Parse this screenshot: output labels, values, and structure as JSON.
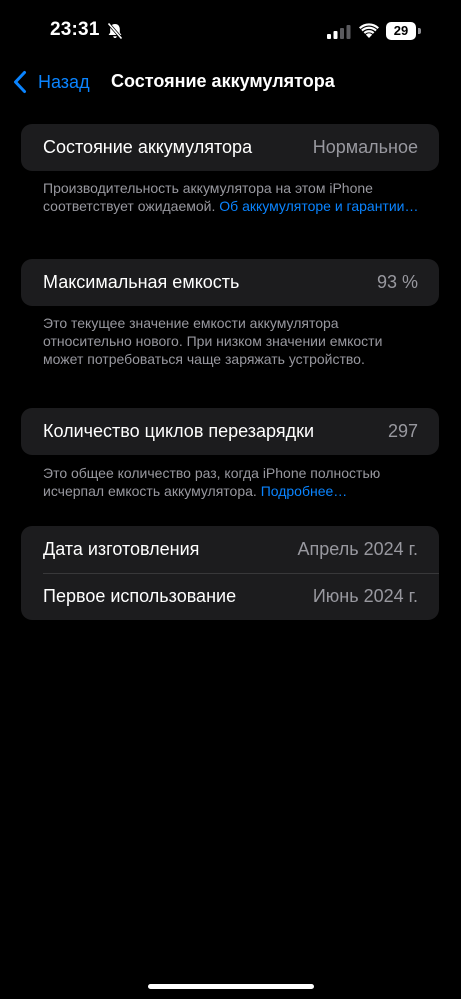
{
  "status_bar": {
    "time": "23:31",
    "battery_level": "29",
    "icons": [
      "bell-slash-icon",
      "signal-icon",
      "wifi-icon",
      "battery-icon"
    ]
  },
  "nav": {
    "back_label": "Назад",
    "title": "Состояние аккумулятора"
  },
  "health": {
    "label": "Состояние аккумулятора",
    "value": "Нормальное",
    "footnote_text": "Производительность аккумулятора на этом iPhone соответствует ожидаемой. ",
    "footnote_link": "Об аккумуляторе и гарантии…"
  },
  "capacity": {
    "label": "Максимальная емкость",
    "value": "93 %",
    "footnote_text": "Это текущее значение емкости аккумулятора относительно нового. При низком значении емкости может потребоваться чаще заряжать устройство."
  },
  "cycles": {
    "label": "Количество циклов перезарядки",
    "value": "297",
    "footnote_text": "Это общее количество раз, когда iPhone полностью исчерпал емкость аккумулятора. ",
    "footnote_link": "Подробнее…"
  },
  "dates": {
    "manufacture_label": "Дата изготовления",
    "manufacture_value": "Апрель 2024 г.",
    "first_use_label": "Первое использование",
    "first_use_value": "Июнь 2024 г."
  },
  "colors": {
    "background": "#000000",
    "group_background": "#1c1c1e",
    "accent": "#0a84ff",
    "secondary_text": "#98989f"
  }
}
